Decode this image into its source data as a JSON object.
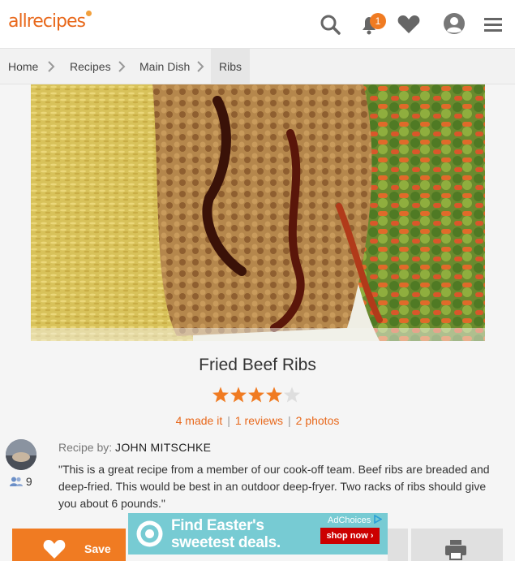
{
  "header": {
    "logo_text": "allrecipes",
    "notification_count": "1",
    "brand_color": "#e8681b",
    "icons": [
      "search-icon",
      "bell-icon",
      "heart-icon",
      "profile-icon",
      "menu-icon"
    ]
  },
  "breadcrumbs": [
    "Home",
    "Recipes",
    "Main Dish",
    "Ribs"
  ],
  "recipe": {
    "title": "Fried Beef Ribs",
    "rating": 4,
    "rating_max": 5,
    "made_it": "4 made it",
    "reviews": "1 reviews",
    "photos": "2 photos",
    "byline_label": "Recipe by:",
    "author": "JOHN MITSCHKE",
    "followers": "9",
    "description": "\"This is a great recipe from a member of our cook-off team. Beef ribs are breaded and deep-fried. This would be best in an outdoor deep-fryer. Two racks of ribs should give you about 6 pounds.\""
  },
  "actions": {
    "save_label": "Save"
  },
  "ad": {
    "adchoices": "AdChoices",
    "line1": "Find Easter's",
    "line2": "sweetest deals.",
    "cta": "shop now ›"
  }
}
